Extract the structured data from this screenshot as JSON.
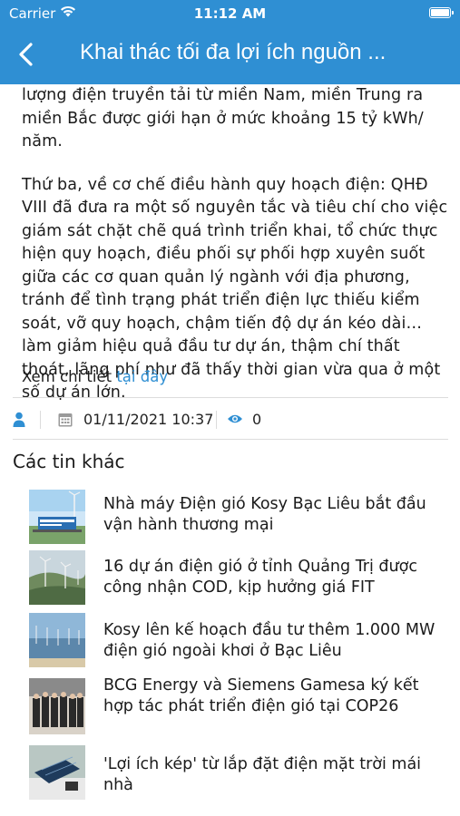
{
  "status_bar": {
    "carrier": "Carrier",
    "time": "11:12 AM"
  },
  "nav": {
    "title": "Khai thác tối đa lợi ích nguồn ..."
  },
  "article": {
    "paragraphs": [
      "lượng điện truyền tải từ miền Nam, miền Trung ra\nmiền Bắc được giới hạn ở mức khoảng 15 tỷ kWh/\nnăm.",
      "Thứ ba, về cơ chế điều hành quy hoạch điện: QHĐ\nVIII đã đưa ra một số nguyên tắc và tiêu chí cho việc\ngiám sát chặt chẽ quá trình triển khai, tổ chức thực\nhiện quy hoạch, điều phối sự phối hợp xuyên suốt\ngiữa các cơ quan quản lý ngành với địa phương,\ntránh để tình trạng phát triển điện lực thiếu kiểm\nsoát, vỡ quy hoạch, chậm tiến độ dự án kéo dài…\nlàm giảm hiệu quả đầu tư dự án, thậm chí thất\nthoát, lãng phí như đã thấy thời gian vừa qua ở một\nsố dự án lớn."
    ],
    "read_more_prefix": "Xem chi tiết",
    "read_more_link": "tại đây"
  },
  "meta": {
    "date": "01/11/2021 10:37",
    "views": "0"
  },
  "related": {
    "heading": "Các tin khác",
    "items": [
      {
        "title": "Nhà máy Điện gió Kosy Bạc Liêu bắt đầu vận hành thương mại"
      },
      {
        "title": "16 dự án điện gió ở tỉnh Quảng Trị được công nhận COD, kịp hưởng giá FIT"
      },
      {
        "title": "Kosy lên kế hoạch đầu tư thêm 1.000 MW điện gió ngoài khơi ở Bạc Liêu"
      },
      {
        "title": "BCG Energy và Siemens Gamesa ký kết hợp tác phát triển điện gió tại COP26"
      },
      {
        "title": "'Lợi ích kép' từ lắp đặt điện mặt trời mái nhà"
      }
    ]
  },
  "colors": {
    "header": "#2f8fd3",
    "link": "#2f8fd3",
    "icon": "#2f8fd3"
  }
}
